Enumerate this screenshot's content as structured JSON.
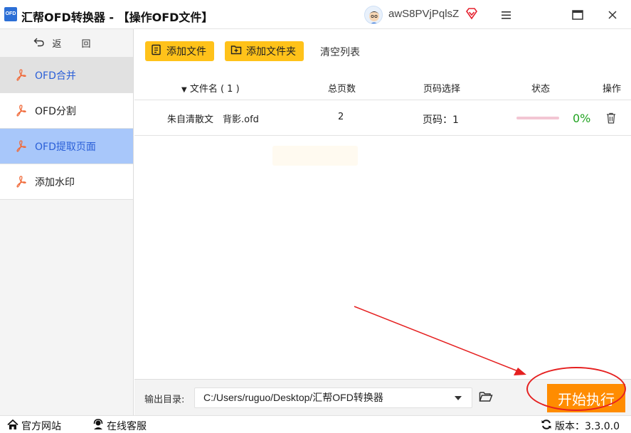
{
  "window": {
    "logo_text": "OFD",
    "title": "汇帮OFD转换器 - 【操作OFD文件】",
    "username": "awS8PVjPqlsZ"
  },
  "sidebar": {
    "back_label": "返 回",
    "items": [
      {
        "label": "OFD合并",
        "icon": "pdf-icon",
        "state": "hover"
      },
      {
        "label": "OFD分割",
        "icon": "pdf-icon",
        "state": "normal"
      },
      {
        "label": "OFD提取页面",
        "icon": "pdf-icon",
        "state": "active"
      },
      {
        "label": "添加水印",
        "icon": "pdf-icon",
        "state": "normal"
      }
    ]
  },
  "toolbar": {
    "add_file": "添加文件",
    "add_folder": "添加文件夹",
    "clear": "清空列表"
  },
  "table": {
    "headers": {
      "filename": "文件名 ( 1 )",
      "pages": "总页数",
      "page_select": "页码选择",
      "status": "状态",
      "action": "操作"
    },
    "rows": [
      {
        "filename": "朱自清散文　背影.ofd",
        "pages": "2",
        "page_select": "页码：1",
        "progress": 0,
        "status": "0%"
      }
    ]
  },
  "output": {
    "label": "输出目录:",
    "path": "C:/Users/ruguo/Desktop/汇帮OFD转换器",
    "start_button": "开始执行"
  },
  "footer": {
    "website": "官方网站",
    "service": "在线客服",
    "version": "版本：3.3.0.0"
  },
  "colors": {
    "accent_yellow": "#ffc21a",
    "start_orange": "#ff8c00",
    "active_blue": "#a8c7fa",
    "link_blue": "#2a5fd8",
    "status_green": "#21a321",
    "annotation_red": "#e52020"
  }
}
